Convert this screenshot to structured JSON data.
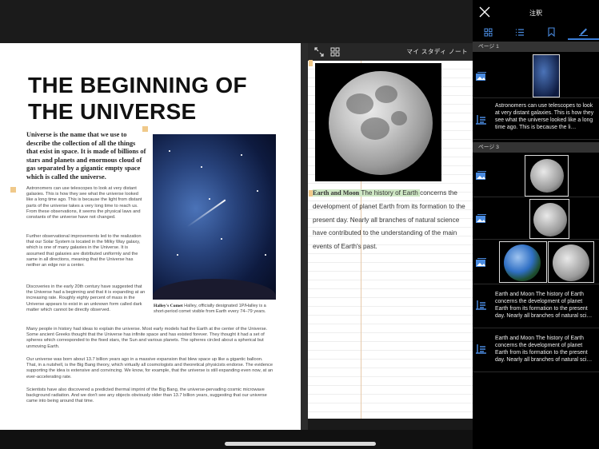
{
  "book": {
    "title": "THE BEGINNING OF THE UNIVERSE",
    "lead": "Universe is the name that we use to describe the collection of all the things that exist in space. It is made of billions of stars and planets and enormous cloud of gas separated by a gigantic empty space which is called the universe.",
    "para1": "Astronomers can use telescopes to look at very distant galaxies. This is how they see what the universe looked like a long time ago. This is because the light from distant parts of the universe takes a very long time to reach us. From these observations, it seems the physical laws and constants of the universe have not changed.",
    "para2": "Further observational improvements led to the realization that our Solar System is located in the Milky Way galaxy, which is one of many galaxies in the Universe. It is assumed that galaxies are distributed uniformly and the same in all directions, meaning that the Universe has neither an edge nor a center.",
    "para3": "Discoveries in the early 20th century have suggested that the Universe had a beginning and that it is expanding at an increasing rate. Roughly eighty percent of mass in the Universe appears to exist in an unknown form called dark matter which cannot be directly observed.",
    "para4": "Many people in history had ideas to explain the universe. Most early models had the Earth at the center of the Universe. Some ancient Greeks thought that the Universe has infinite space and has existed forever. They thought it had a set of spheres which corresponded to the fixed stars, the Sun and various planets. The spheres circled about a spherical but unmoving Earth.",
    "para5": "Our universe was born about 13.7 billion years ago in a massive expansion that blew space up like a gigantic balloon. That, in a nutshell, is the Big Bang theory, which virtually all cosmologists and theoretical physicists endorse. The evidence supporting the idea is extensive and convincing. We know, for example, that the universe is still expanding even now, at an ever-accelerating rate.",
    "para6": "Scientists have also discovered a predicted thermal imprint of the Big Bang, the universe-pervading cosmic microwave background radiation. And we don't see any objects obviously older than 13.7 billion years, suggesting that our universe came into being around that time.",
    "caption_term": "Halley's Comet",
    "caption_text": " Halley, officially designated 1P/Halley is a short-period comet visible from Earth every 74–79 years."
  },
  "notebook": {
    "title": "マイ スタディ ノート",
    "note_term": "Earth and Moon",
    "note_highlight": " The history of Earth ",
    "note_rest": "concerns the development of planet Earth from its formation to the present day. Nearly all branches of natural science have contributed to the understanding of the main events of Earth's past."
  },
  "sidebar": {
    "title": "注釈",
    "section1": "ページ 1",
    "section3": "ページ 3",
    "ann1_text": "Astronomers can use telescopes to look at very distant galaxies. This is how they see what the universe looked like a long time ago. This is because the li…",
    "ann_earth_text_1": "Earth and Moon The history of Earth concerns the development of planet Earth from its formation to the present day. Nearly all branches of natural sci…",
    "ann_earth_text_2": "Earth and Moon The history of Earth concerns the development of planet Earth from its formation to the present day. Nearly all branches of natural sci…"
  },
  "colors": {
    "accent": "#3b7ed8",
    "highlight": "#cfe8c5",
    "marker": "#f0c98a"
  },
  "icons": [
    "close-icon",
    "thumbnail-grid-icon",
    "list-icon",
    "bookmark-icon",
    "pen-icon",
    "expand-icon",
    "grid-icon",
    "image-annotation-icon",
    "text-annotation-icon"
  ]
}
